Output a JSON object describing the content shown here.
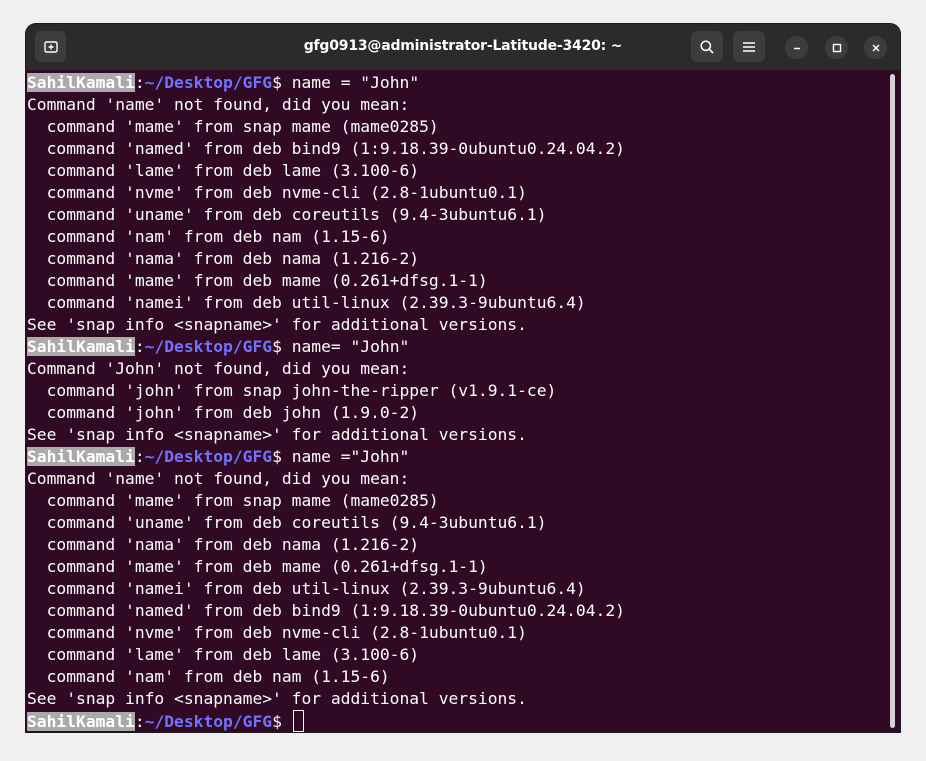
{
  "window": {
    "title": "gfg0913@administrator-Latitude-3420: ~"
  },
  "icons": {
    "new_tab": "new-tab-icon",
    "search": "search-icon",
    "menu": "hamburger-menu-icon",
    "minimize": "minimize-icon",
    "maximize": "maximize-icon",
    "close": "close-icon"
  },
  "colors": {
    "terminal_bg": "#300a24",
    "titlebar_bg": "#2b2b2b",
    "user_highlight": "#aaaaaa",
    "path": "#7272ff",
    "text": "#ffffff"
  },
  "prompt": {
    "user": "SahilKamali",
    "path": "~/Desktop/GFG",
    "symbol": "$"
  },
  "lines": [
    {
      "type": "prompt",
      "cmd": " name = \"John\""
    },
    {
      "type": "out",
      "text": "Command 'name' not found, did you mean:"
    },
    {
      "type": "out",
      "text": "  command 'mame' from snap mame (mame0285)"
    },
    {
      "type": "out",
      "text": "  command 'named' from deb bind9 (1:9.18.39-0ubuntu0.24.04.2)"
    },
    {
      "type": "out",
      "text": "  command 'lame' from deb lame (3.100-6)"
    },
    {
      "type": "out",
      "text": "  command 'nvme' from deb nvme-cli (2.8-1ubuntu0.1)"
    },
    {
      "type": "out",
      "text": "  command 'uname' from deb coreutils (9.4-3ubuntu6.1)"
    },
    {
      "type": "out",
      "text": "  command 'nam' from deb nam (1.15-6)"
    },
    {
      "type": "out",
      "text": "  command 'nama' from deb nama (1.216-2)"
    },
    {
      "type": "out",
      "text": "  command 'mame' from deb mame (0.261+dfsg.1-1)"
    },
    {
      "type": "out",
      "text": "  command 'namei' from deb util-linux (2.39.3-9ubuntu6.4)"
    },
    {
      "type": "out",
      "text": "See 'snap info <snapname>' for additional versions."
    },
    {
      "type": "prompt",
      "cmd": " name= \"John\""
    },
    {
      "type": "out",
      "text": "Command 'John' not found, did you mean:"
    },
    {
      "type": "out",
      "text": "  command 'john' from snap john-the-ripper (v1.9.1-ce)"
    },
    {
      "type": "out",
      "text": "  command 'john' from deb john (1.9.0-2)"
    },
    {
      "type": "out",
      "text": "See 'snap info <snapname>' for additional versions."
    },
    {
      "type": "prompt",
      "cmd": " name =\"John\""
    },
    {
      "type": "out",
      "text": "Command 'name' not found, did you mean:"
    },
    {
      "type": "out",
      "text": "  command 'mame' from snap mame (mame0285)"
    },
    {
      "type": "out",
      "text": "  command 'uname' from deb coreutils (9.4-3ubuntu6.1)"
    },
    {
      "type": "out",
      "text": "  command 'nama' from deb nama (1.216-2)"
    },
    {
      "type": "out",
      "text": "  command 'mame' from deb mame (0.261+dfsg.1-1)"
    },
    {
      "type": "out",
      "text": "  command 'namei' from deb util-linux (2.39.3-9ubuntu6.4)"
    },
    {
      "type": "out",
      "text": "  command 'named' from deb bind9 (1:9.18.39-0ubuntu0.24.04.2)"
    },
    {
      "type": "out",
      "text": "  command 'nvme' from deb nvme-cli (2.8-1ubuntu0.1)"
    },
    {
      "type": "out",
      "text": "  command 'lame' from deb lame (3.100-6)"
    },
    {
      "type": "out",
      "text": "  command 'nam' from deb nam (1.15-6)"
    },
    {
      "type": "out",
      "text": "See 'snap info <snapname>' for additional versions."
    },
    {
      "type": "prompt",
      "cmd": " ",
      "cursor": true
    }
  ]
}
